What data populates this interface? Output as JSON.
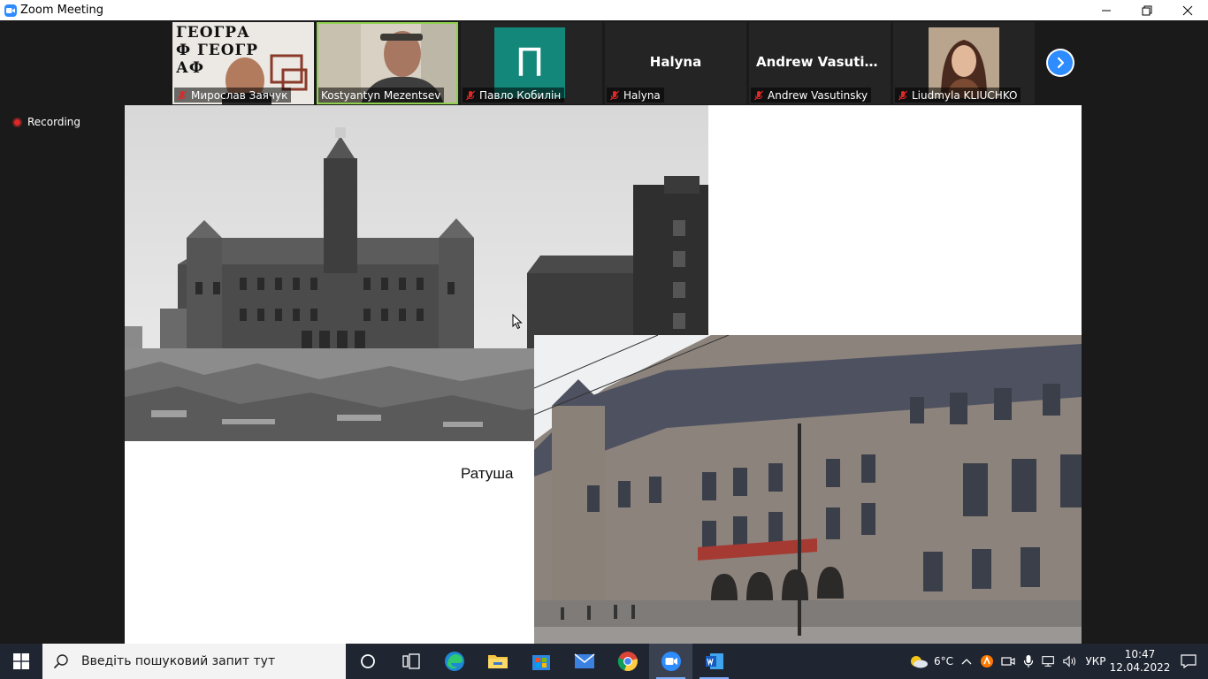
{
  "window": {
    "title": "Zoom Meeting"
  },
  "participants": [
    {
      "name": "Мирослав Заячук",
      "muted": true,
      "type": "video"
    },
    {
      "name": "Kostyantyn Mezentsev",
      "muted": false,
      "type": "video",
      "active_speaker": true
    },
    {
      "name": "Павло Кобилін",
      "muted": true,
      "type": "letter",
      "letter": "П"
    },
    {
      "name": "Halyna",
      "display_name": "Halyna",
      "muted": true,
      "type": "name"
    },
    {
      "name": "Andrew Vasutinsky",
      "display_name": "Andrew  Vasutin...",
      "muted": true,
      "type": "name"
    },
    {
      "name": "Liudmyla KLIUCHKO",
      "muted": true,
      "type": "photo"
    }
  ],
  "tile1_sign": "ГЕОГРАФ ГЕОГРАФ",
  "recording": {
    "label": "Recording"
  },
  "shared_screen": {
    "caption": "Ратуша"
  },
  "taskbar": {
    "search_placeholder": "Введіть пошуковий запит тут",
    "apps": [
      "task-view",
      "edge",
      "file-explorer",
      "microsoft-store",
      "mail",
      "chrome",
      "zoom",
      "word"
    ],
    "weather": "6°C",
    "language": "УКР",
    "time": "10:47",
    "date": "12.04.2022"
  },
  "colors": {
    "zoom_blue": "#2d8cff",
    "active_speaker": "#8fd14f",
    "letter_avatar": "#12877a",
    "taskbar": "#1f2531"
  }
}
